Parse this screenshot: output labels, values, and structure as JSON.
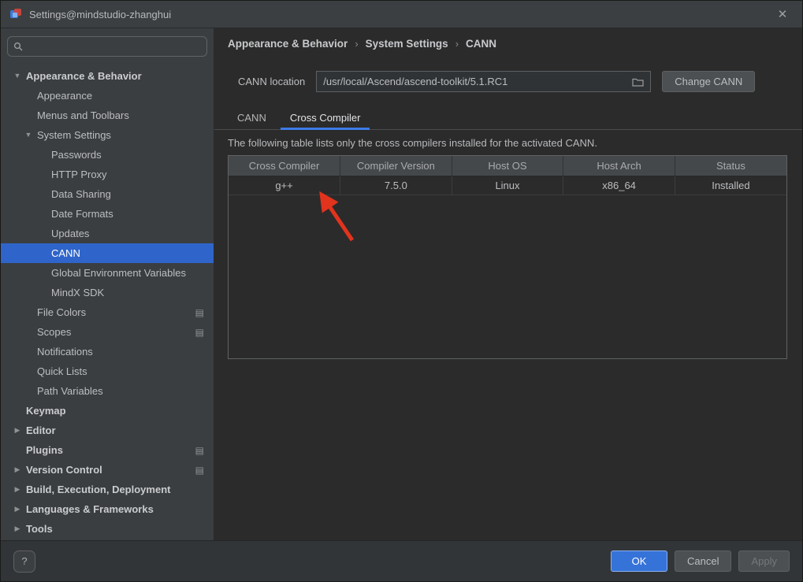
{
  "window": {
    "title": "Settings@mindstudio-zhanghui",
    "close_glyph": "✕"
  },
  "icons": {
    "chevron_down": "▼",
    "chevron_right": "▶",
    "detail": "▤",
    "separator": "›"
  },
  "colors": {
    "selection": "#2f65ca",
    "accent": "#3d7be8",
    "ok-bg": "#3673d9",
    "arrow": "#e2331d",
    "titlebar-bg": "#3c3f41",
    "sidebar-bg": "#3b3e40",
    "main-bg": "#2b2b2b"
  },
  "sidebar": {
    "items": [
      {
        "label": "Appearance & Behavior",
        "indent": 0,
        "bold": true,
        "chevron": "down"
      },
      {
        "label": "Appearance",
        "indent": 1
      },
      {
        "label": "Menus and Toolbars",
        "indent": 1
      },
      {
        "label": "System Settings",
        "indent": 1,
        "chevron": "down"
      },
      {
        "label": "Passwords",
        "indent": 2
      },
      {
        "label": "HTTP Proxy",
        "indent": 2
      },
      {
        "label": "Data Sharing",
        "indent": 2
      },
      {
        "label": "Date Formats",
        "indent": 2
      },
      {
        "label": "Updates",
        "indent": 2
      },
      {
        "label": "CANN",
        "indent": 2,
        "selected": true
      },
      {
        "label": "Global Environment Variables",
        "indent": 2
      },
      {
        "label": "MindX SDK",
        "indent": 2
      },
      {
        "label": "File Colors",
        "indent": 1,
        "trailing_icon": true
      },
      {
        "label": "Scopes",
        "indent": 1,
        "trailing_icon": true
      },
      {
        "label": "Notifications",
        "indent": 1
      },
      {
        "label": "Quick Lists",
        "indent": 1
      },
      {
        "label": "Path Variables",
        "indent": 1
      },
      {
        "label": "Keymap",
        "indent": 0,
        "bold": true
      },
      {
        "label": "Editor",
        "indent": 0,
        "bold": true,
        "chevron": "right"
      },
      {
        "label": "Plugins",
        "indent": 0,
        "bold": true,
        "trailing_icon": true
      },
      {
        "label": "Version Control",
        "indent": 0,
        "bold": true,
        "chevron": "right",
        "trailing_icon": true
      },
      {
        "label": "Build, Execution, Deployment",
        "indent": 0,
        "bold": true,
        "chevron": "right"
      },
      {
        "label": "Languages & Frameworks",
        "indent": 0,
        "bold": true,
        "chevron": "right"
      },
      {
        "label": "Tools",
        "indent": 0,
        "bold": true,
        "chevron": "right"
      }
    ]
  },
  "breadcrumb": {
    "items": [
      "Appearance & Behavior",
      "System Settings",
      "CANN"
    ]
  },
  "cann_location": {
    "label": "CANN location",
    "value": "/usr/local/Ascend/ascend-toolkit/5.1.RC1",
    "button_label": "Change CANN"
  },
  "tabs": [
    {
      "label": "CANN",
      "active": false
    },
    {
      "label": "Cross Compiler",
      "active": true
    }
  ],
  "note": "The following table lists only the cross compilers installed for the activated CANN.",
  "table": {
    "headers": [
      "Cross Compiler",
      "Compiler Version",
      "Host OS",
      "Host Arch",
      "Status"
    ],
    "rows": [
      [
        "g++",
        "7.5.0",
        "Linux",
        "x86_64",
        "Installed"
      ]
    ]
  },
  "footer": {
    "help_label": "?",
    "ok_label": "OK",
    "cancel_label": "Cancel",
    "apply_label": "Apply"
  }
}
